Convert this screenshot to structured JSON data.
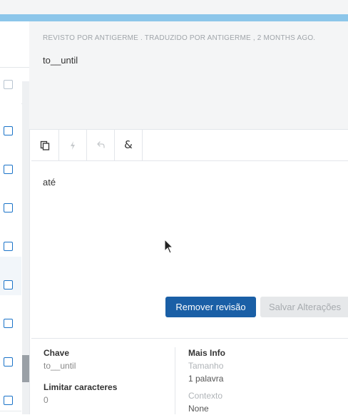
{
  "source": {
    "meta": "REVISTO POR ANTIGERME . TRADUZIDO POR ANTIGERME , 2 MONTHS AGO.",
    "text": "to__until"
  },
  "toolbar": {
    "buttons": [
      {
        "name": "copy-source",
        "icon": "copy-icon",
        "enabled": true
      },
      {
        "name": "machine-translate",
        "icon": "bolt-icon",
        "enabled": false
      },
      {
        "name": "undo",
        "icon": "undo-icon",
        "enabled": false
      },
      {
        "name": "placeholders",
        "icon": "ampersand-icon",
        "enabled": true
      }
    ]
  },
  "editor": {
    "value": "até"
  },
  "actions": {
    "remove_label": "Remover revisão",
    "save_label": "Salvar Alterações"
  },
  "info": {
    "key_label": "Chave",
    "key_value": "to__until",
    "limit_label": "Limitar caracteres",
    "limit_value": "0",
    "more_label": "Mais Info",
    "size_label": "Tamanho",
    "size_value": "1 palavra",
    "context_label": "Contexto",
    "context_value": "None"
  },
  "colors": {
    "accent": "#1a5fa6",
    "top_stripe": "#8cc6ea",
    "checkbox": "#1a73c8"
  }
}
